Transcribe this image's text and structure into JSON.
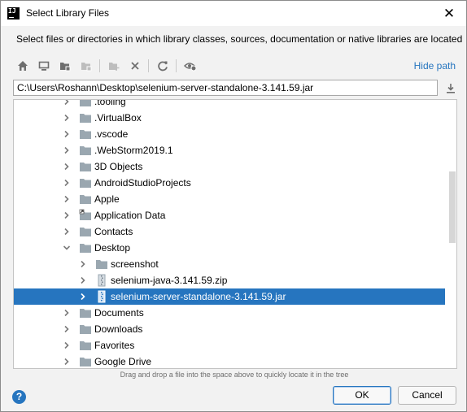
{
  "window": {
    "title": "Select Library Files",
    "close_glyph": "✕"
  },
  "instruction": "Select files or directories in which library classes, sources, documentation or native libraries are located",
  "toolbar": {
    "buttons": [
      {
        "name": "home-icon",
        "enabled": true
      },
      {
        "name": "desktop-icon",
        "enabled": true
      },
      {
        "name": "project-folder-icon",
        "enabled": true
      },
      {
        "name": "module-folder-icon",
        "enabled": false
      },
      {
        "name": "new-folder-icon",
        "enabled": false
      },
      {
        "name": "delete-icon",
        "enabled": true
      },
      {
        "name": "refresh-icon",
        "enabled": true
      },
      {
        "name": "show-hidden-icon",
        "enabled": true
      }
    ],
    "hide_path_label": "Hide path"
  },
  "path_value": "C:\\Users\\Roshann\\Desktop\\selenium-server-standalone-3.141.59.jar",
  "tree": {
    "rows": [
      {
        "label": ".tooling",
        "level": 1,
        "type": "folder",
        "expanded": false
      },
      {
        "label": ".VirtualBox",
        "level": 1,
        "type": "folder",
        "expanded": false
      },
      {
        "label": ".vscode",
        "level": 1,
        "type": "folder",
        "expanded": false
      },
      {
        "label": ".WebStorm2019.1",
        "level": 1,
        "type": "folder",
        "expanded": false
      },
      {
        "label": "3D Objects",
        "level": 1,
        "type": "folder",
        "expanded": false
      },
      {
        "label": "AndroidStudioProjects",
        "level": 1,
        "type": "folder",
        "expanded": false
      },
      {
        "label": "Apple",
        "level": 1,
        "type": "folder",
        "expanded": false
      },
      {
        "label": "Application Data",
        "level": 1,
        "type": "link-folder",
        "expanded": false
      },
      {
        "label": "Contacts",
        "level": 1,
        "type": "folder",
        "expanded": false
      },
      {
        "label": "Desktop",
        "level": 1,
        "type": "folder",
        "expanded": true
      },
      {
        "label": "screenshot",
        "level": 2,
        "type": "folder",
        "expanded": false
      },
      {
        "label": "selenium-java-3.141.59.zip",
        "level": 2,
        "type": "archive",
        "expanded": false
      },
      {
        "label": "selenium-server-standalone-3.141.59.jar",
        "level": 2,
        "type": "archive",
        "expanded": false,
        "selected": true
      },
      {
        "label": "Documents",
        "level": 1,
        "type": "folder",
        "expanded": false
      },
      {
        "label": "Downloads",
        "level": 1,
        "type": "folder",
        "expanded": false
      },
      {
        "label": "Favorites",
        "level": 1,
        "type": "folder",
        "expanded": false
      },
      {
        "label": "Google Drive",
        "level": 1,
        "type": "folder",
        "expanded": false
      }
    ]
  },
  "hint": "Drag and drop a file into the space above to quickly locate it in the tree",
  "buttons": {
    "help": "?",
    "ok": "OK",
    "cancel": "Cancel"
  },
  "colors": {
    "accent": "#2675bf",
    "folder": "#9aa7b0",
    "icon": "#6e6e6e",
    "disabled_icon": "#bdbdbd"
  }
}
